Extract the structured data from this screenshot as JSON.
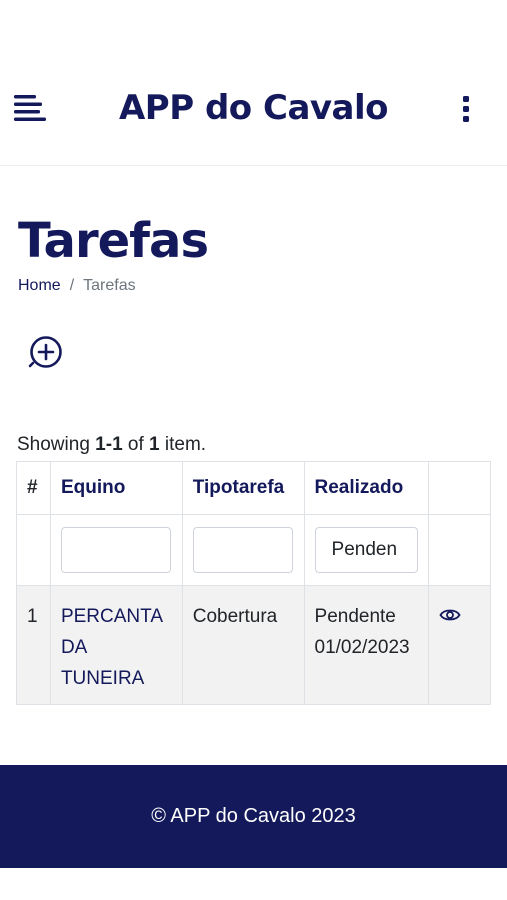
{
  "header": {
    "app_title": "APP do Cavalo"
  },
  "page": {
    "title": "Tarefas",
    "breadcrumb": {
      "home": "Home",
      "separator": "/",
      "current": "Tarefas"
    }
  },
  "summary": {
    "prefix": "Showing ",
    "range": "1-1",
    "middle": " of ",
    "total": "1",
    "suffix": " item."
  },
  "table": {
    "headers": {
      "num": "#",
      "equino": "Equino",
      "tipotarefa": "Tipotarefa",
      "realizado": "Realizado"
    },
    "filters": {
      "equino": "",
      "tipotarefa": "",
      "realizado": "Penden"
    },
    "rows": [
      {
        "num": "1",
        "equino_line1": "PERCANTA",
        "equino_line2": "DA",
        "equino_line3": "TUNEIRA",
        "tipotarefa": "Cobertura",
        "realizado_line1": "Pendente",
        "realizado_line2": "01/02/2023",
        "action_icon": "eye-icon"
      }
    ]
  },
  "footer": {
    "text": "© APP do Cavalo 2023"
  },
  "colors": {
    "brand": "#13195a",
    "row_bg": "#f2f2f2"
  }
}
